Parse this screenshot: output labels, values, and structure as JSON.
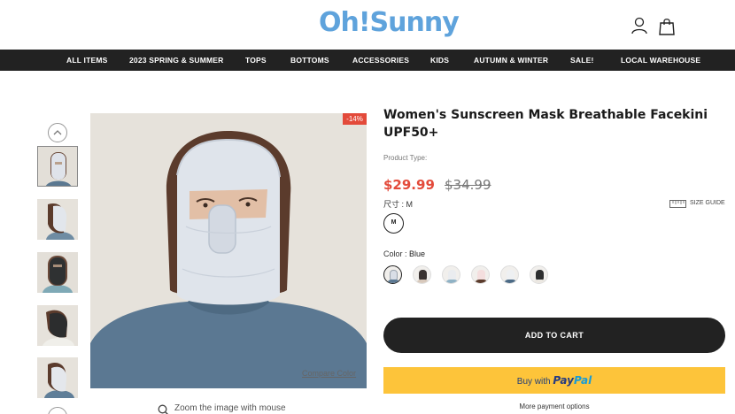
{
  "header": {
    "logo": "Oh!Sunny",
    "icons": {
      "account": "user-icon",
      "cart": "shopping-bag-icon"
    }
  },
  "nav": {
    "items": [
      "ALL ITEMS",
      "2023 SPRING & SUMMER",
      "TOPS",
      "BOTTOMS",
      "ACCESSORIES",
      "KIDS",
      "AUTUMN & WINTER",
      "SALE!",
      "LOCAL WAREHOUSE"
    ]
  },
  "gallery": {
    "discount_badge": "-14%",
    "compare_link": "Compare Color",
    "zoom_hint": "Zoom the image with mouse",
    "thumbnails": [
      "white-mask",
      "white-mask-side",
      "black-mask",
      "black-mask-side",
      "white-mask-back"
    ]
  },
  "product": {
    "title": "Women's Sunscreen Mask Breathable Facekini UPF50+",
    "product_type_label": "Product Type:",
    "price": "$29.99",
    "compare_price": "$34.99",
    "size_label": "尺寸 : M",
    "size_guide": "SIZE GUIDE",
    "sizes": [
      "M"
    ],
    "color_label": "Color : ",
    "color_value": "Blue",
    "add_to_cart": "ADD TO CART",
    "paypal_prefix": "Buy with",
    "paypal_brand_1": "Pay",
    "paypal_brand_2": "Pal",
    "more_payment": "More payment options"
  },
  "colors": {
    "accent_red": "#e34a3a",
    "logo_blue": "#5fa3dc",
    "nav_bg": "#222222",
    "paypal_yellow": "#fdc43a"
  }
}
